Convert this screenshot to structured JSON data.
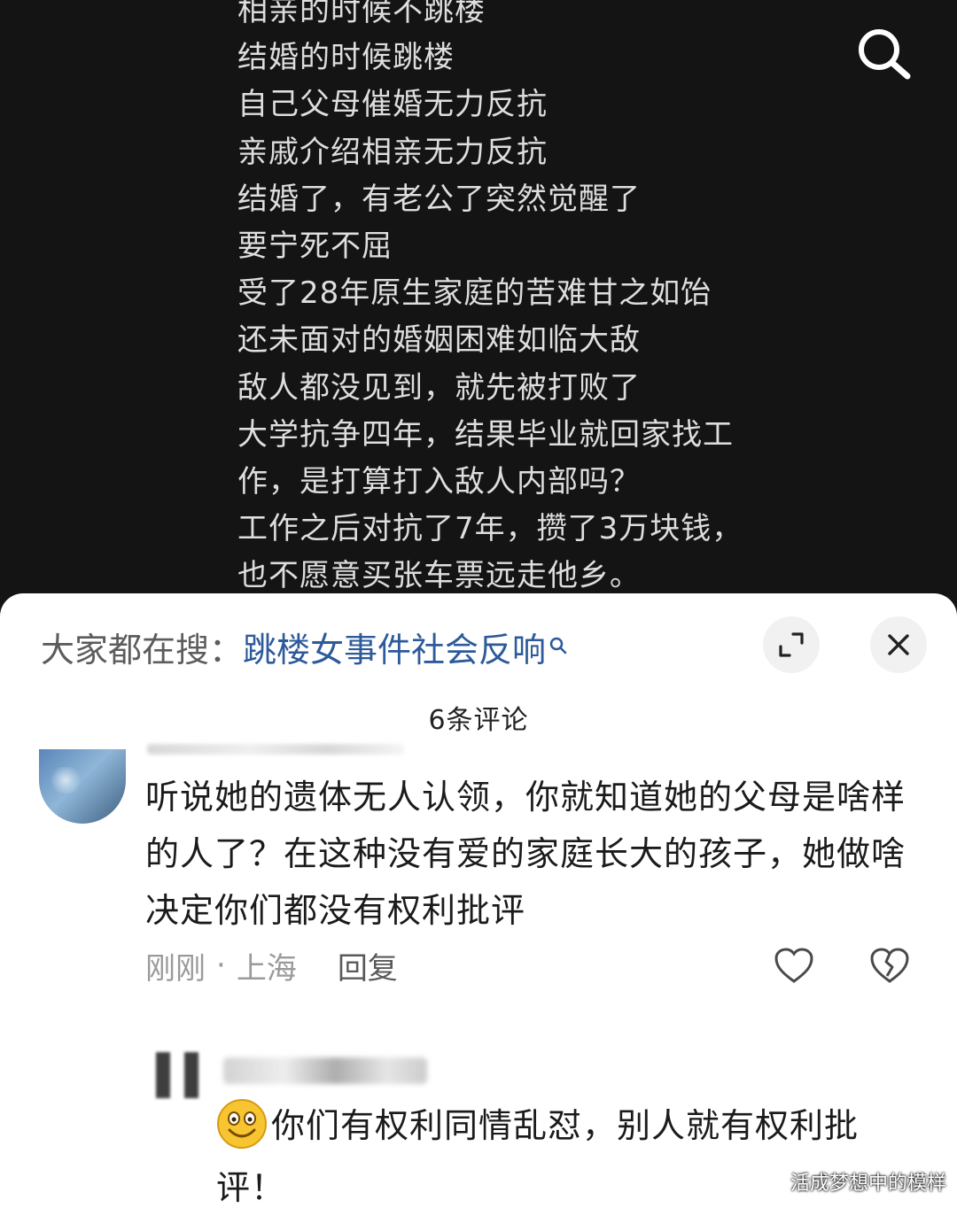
{
  "video": {
    "lyrics": [
      "相亲的时候不跳楼",
      "结婚的时候跳楼",
      "自己父母催婚无力反抗",
      "亲戚介绍相亲无力反抗",
      "结婚了，有老公了突然觉醒了",
      "要宁死不屈",
      "受了28年原生家庭的苦难甘之如饴",
      "还未面对的婚姻困难如临大敌",
      "敌人都没见到，就先被打败了",
      "大学抗争四年，结果毕业就回家找工",
      "作，是打算打入敌人内部吗？",
      "工作之后对抗了7年，攒了3万块钱，",
      "也不愿意买张车票远走他乡。"
    ],
    "search_icon": "search-icon"
  },
  "sheet": {
    "search_prefix": "大家都在搜：",
    "search_term": "跳楼女事件社会反响",
    "comment_count": "6条评论",
    "comment": {
      "text": "听说她的遗体无人认领，你就知道她的父母是啥样的人了？在这种没有爱的家庭长大的孩子，她做啥决定你们都没有权利批评",
      "time": "刚刚",
      "separator": "·",
      "location": "上海",
      "reply_label": "回复"
    },
    "reply": {
      "text": "你们有权利同情乱怼，别人就有权利批评！"
    }
  },
  "watermark": "活成梦想中的模样",
  "colors": {
    "background": "#121212",
    "sheet": "#ffffff",
    "search_term": "#2d5a9a",
    "meta": "#9a9a9a"
  }
}
